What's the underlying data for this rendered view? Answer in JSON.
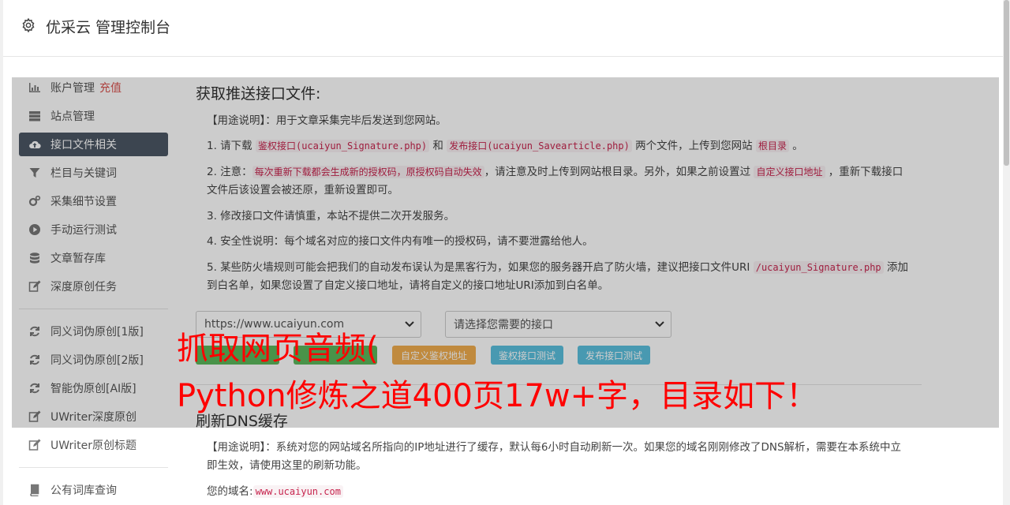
{
  "header": {
    "title": "优采云 管理控制台",
    "icon": "gear-icon"
  },
  "sidebar": {
    "items": [
      {
        "label": "账户管理",
        "badge": "充值",
        "icon": "bar-chart-icon"
      },
      {
        "label": "站点管理",
        "icon": "server-icon"
      },
      {
        "label": "接口文件相关",
        "icon": "cloud-upload-icon",
        "active": true
      },
      {
        "label": "栏目与关键词",
        "icon": "filter-icon"
      },
      {
        "label": "采集细节设置",
        "icon": "cogs-icon"
      },
      {
        "label": "手动运行测试",
        "icon": "play-circle-icon"
      },
      {
        "label": "文章暂存库",
        "icon": "database-icon"
      },
      {
        "label": "深度原创任务",
        "icon": "edit-icon"
      },
      {
        "label": "同义词伪原创[1版]",
        "icon": "refresh-icon"
      },
      {
        "label": "同义词伪原创[2版]",
        "icon": "refresh-icon"
      },
      {
        "label": "智能伪原创[AI版]",
        "icon": "refresh-icon"
      },
      {
        "label": "UWriter深度原创",
        "icon": "edit-icon"
      },
      {
        "label": "UWriter原创标题",
        "icon": "edit-icon"
      },
      {
        "label": "公有词库查询",
        "icon": "book-icon"
      }
    ]
  },
  "section1": {
    "title": "获取推送接口文件:",
    "usage": "【用途说明】：用于文章采集完毕后发送到您网站。",
    "p1": {
      "a": "1. 请下载 ",
      "code1": "鉴权接口(ucaiyun_Signature.php)",
      "b": " 和 ",
      "code2": "发布接口(ucaiyun_Savearticle.php)",
      "c": " 两个文件，上传到您网站 ",
      "code3": "根目录",
      "d": " 。"
    },
    "p2": {
      "a": "2. 注意：",
      "code1": "每次重新下载都会生成新的授权码，原授权码自动失效",
      "b": "，请注意及时上传到网站根目录。另外，如果之前设置过 ",
      "code2": "自定义接口地址",
      "c": " ，重新下载接口文件后该设置会被还原，重新设置即可。"
    },
    "p3": "3. 修改接口文件请慎重，本站不提供二次开发服务。",
    "p4": "4. 安全性说明：每个域名对应的接口文件内有唯一的授权码，请不要泄露给他人。",
    "p5": {
      "a": "5. 某些防火墙规则可能会把我们的自动发布误认为是黑客行为，如果您的服务器开启了防火墙，建议把接口文件URI ",
      "code1": "/ucaiyun_Signature.php",
      "b": " 添加到白名单，如果您设置了自定义接口地址，请将自定义的接口地址URI添加到白名单。"
    },
    "site_select": "https://www.ucaiyun.com",
    "api_select": "请选择您需要的接口",
    "buttons": {
      "custom": "自定义鉴权地址",
      "test_auth": "鉴权接口测试",
      "test_publish": "发布接口测试"
    }
  },
  "section2": {
    "title": "刷新DNS缓存",
    "usage": "【用途说明】：系统对您的网站域名所指向的IP地址进行了缓存，默认每6小时自动刷新一次。如果您的域名刚刚修改了DNS解析，需要在本系统中立即生效，请使用这里的刷新功能。",
    "domain_label": "您的域名:",
    "domain": "www.ucaiyun.com"
  },
  "watermark": {
    "line1": "抓取网页音频(",
    "line2": "Python修炼之道400页17w+字，目录如下！"
  },
  "colors": {
    "active_nav": "#4c5765",
    "badge": "#d9534f",
    "code": "#c7254e",
    "watermark": "#ff0000",
    "btn_warning": "#f0ad4e",
    "btn_info": "#5bc0de",
    "btn_primary": "#337ab7",
    "btn_success": "#5cb85c"
  }
}
